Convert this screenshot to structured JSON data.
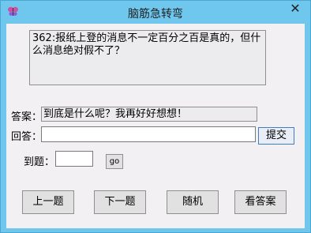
{
  "window": {
    "title": "脑筋急转弯",
    "close_glyph": "✕",
    "app_icon": "butterfly-icon"
  },
  "question": {
    "text": "362:报纸上登的消息不一定百分之百是真的，但什么消息绝对假不了？"
  },
  "answer": {
    "label": "答案：",
    "value": "到底是什么呢？我再好好想想！"
  },
  "reply": {
    "label": "回答：",
    "value": "",
    "submit_label": "提交"
  },
  "goto": {
    "label": "到题：",
    "value": "",
    "go_label": "go"
  },
  "nav": {
    "prev_label": "上一题",
    "next_label": "下一题",
    "random_label": "随机",
    "show_answer_label": "看答案"
  }
}
